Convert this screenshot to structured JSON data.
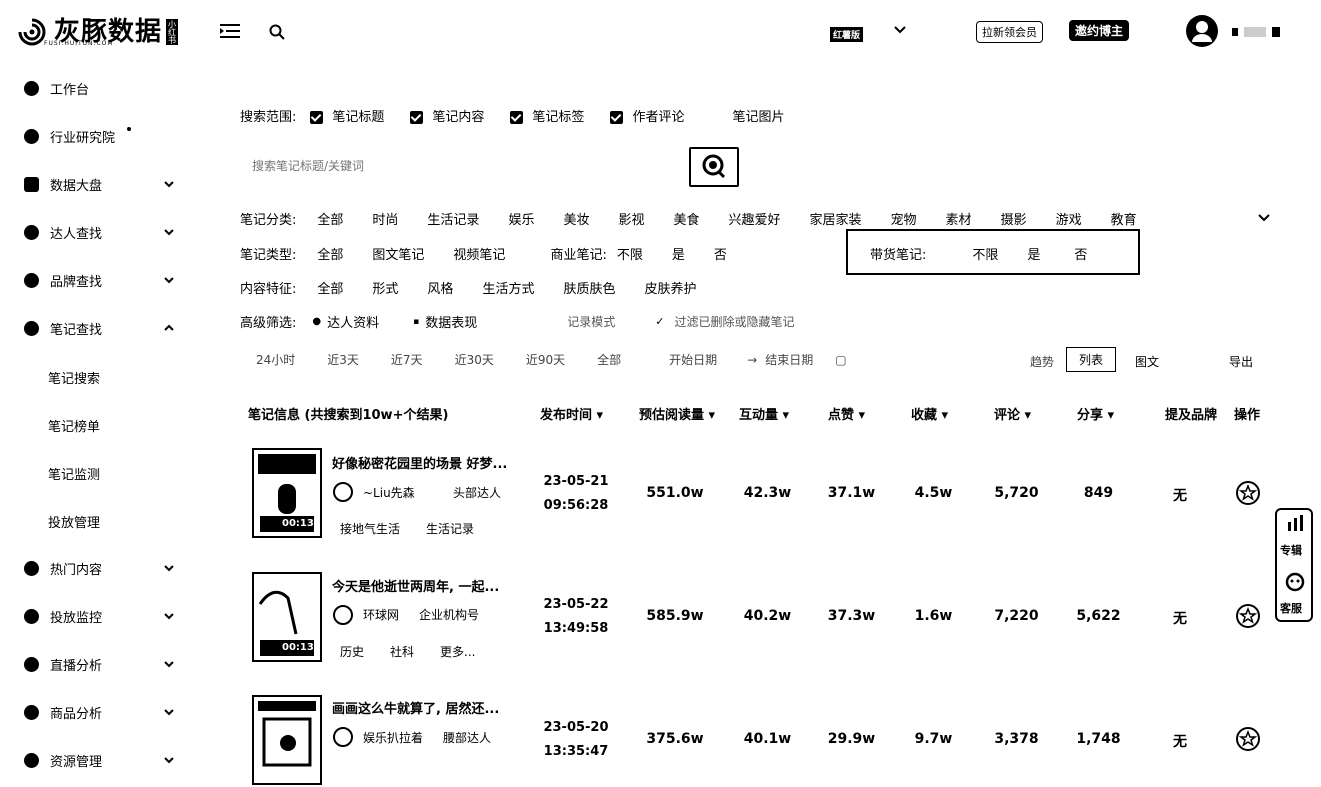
{
  "header": {
    "logo_text": "灰豚数据",
    "logo_sub": "FUSI.HUITUN.COM",
    "logo_badge": "小红书",
    "edition": "红薯版",
    "invite_label": "拉新领会员",
    "promo_label": "邀约博主"
  },
  "sidebar": {
    "items": [
      {
        "label": "工作台"
      },
      {
        "label": "行业研究院"
      },
      {
        "label": "数据大盘"
      },
      {
        "label": "达人查找"
      },
      {
        "label": "品牌查找"
      },
      {
        "label": "笔记查找"
      },
      {
        "label": "热门内容"
      },
      {
        "label": "投放监控"
      },
      {
        "label": "直播分析"
      },
      {
        "label": "商品分析"
      },
      {
        "label": "资源管理"
      }
    ],
    "sub_items": [
      "笔记搜索",
      "笔记榜单",
      "笔记监测",
      "投放管理"
    ]
  },
  "filters": {
    "scope_label": "搜索范围:",
    "scope_options": [
      "笔记标题",
      "笔记内容",
      "笔记标签",
      "作者评论",
      "笔记图片"
    ],
    "search_placeholder": "搜索笔记标题/关键词",
    "category_label": "笔记分类:",
    "categories": [
      "全部",
      "时尚",
      "生活记录",
      "娱乐",
      "美妆",
      "影视",
      "美食",
      "兴趣爱好",
      "家居家装",
      "宠物",
      "素材",
      "摄影",
      "游戏",
      "教育"
    ],
    "type_label": "笔记类型:",
    "types": [
      "全部",
      "图文笔记",
      "视频笔记"
    ],
    "commercial_label": "商业笔记:",
    "commercial_options": [
      "不限",
      "是",
      "否"
    ],
    "goods_label": "带货笔记:",
    "goods_options": [
      "不限",
      "是",
      "否"
    ],
    "feature_label": "内容特征:",
    "features": [
      "全部",
      "形式",
      "风格",
      "生活方式",
      "肤质肤色",
      "皮肤养护"
    ],
    "advanced_label": "高级筛选:",
    "advanced": [
      "达人资料",
      "数据表现",
      "记录模式",
      "过滤已删除或隐藏笔记"
    ],
    "time_ranges": [
      "24小时",
      "近3天",
      "近7天",
      "近30天",
      "近90天",
      "全部",
      "开始日期",
      "结束日期"
    ],
    "view_options": [
      "趋势",
      "列表",
      "图文"
    ],
    "export_label": "导出"
  },
  "table": {
    "headers": [
      "笔记信息 (共搜索到10w+个结果)",
      "发布时间",
      "预估阅读量",
      "互动量",
      "点赞",
      "收藏",
      "评论",
      "分享",
      "提及品牌",
      "操作"
    ],
    "rows": [
      {
        "title": "好像秘密花园里的场景 好梦...",
        "author": "~Liu先森",
        "author_type": "头部达人",
        "tags": [
          "接地气生活",
          "生活记录"
        ],
        "date": "23-05-21",
        "time": "09:56:28",
        "reads": "551.0w",
        "interact": "42.3w",
        "likes": "37.1w",
        "collects": "4.5w",
        "comments": "5,720",
        "shares": "849",
        "brand": "无",
        "duration": "00:13"
      },
      {
        "title": "今天是他逝世两周年, 一起...",
        "author": "环球网",
        "author_type": "企业机构号",
        "tags": [
          "历史",
          "社科",
          "更多..."
        ],
        "date": "23-05-22",
        "time": "13:49:58",
        "reads": "585.9w",
        "interact": "40.2w",
        "likes": "37.3w",
        "collects": "1.6w",
        "comments": "7,220",
        "shares": "5,622",
        "brand": "无",
        "duration": "00:13"
      },
      {
        "title": "画画这么牛就算了, 居然还...",
        "author": "娱乐扒拉着",
        "author_type": "腰部达人",
        "tags": [],
        "date": "23-05-20",
        "time": "13:35:47",
        "reads": "375.6w",
        "interact": "40.1w",
        "likes": "29.9w",
        "collects": "9.7w",
        "comments": "3,378",
        "shares": "1,748",
        "brand": "无",
        "duration": ""
      }
    ]
  },
  "float_panel": [
    "专辑",
    "客服"
  ]
}
